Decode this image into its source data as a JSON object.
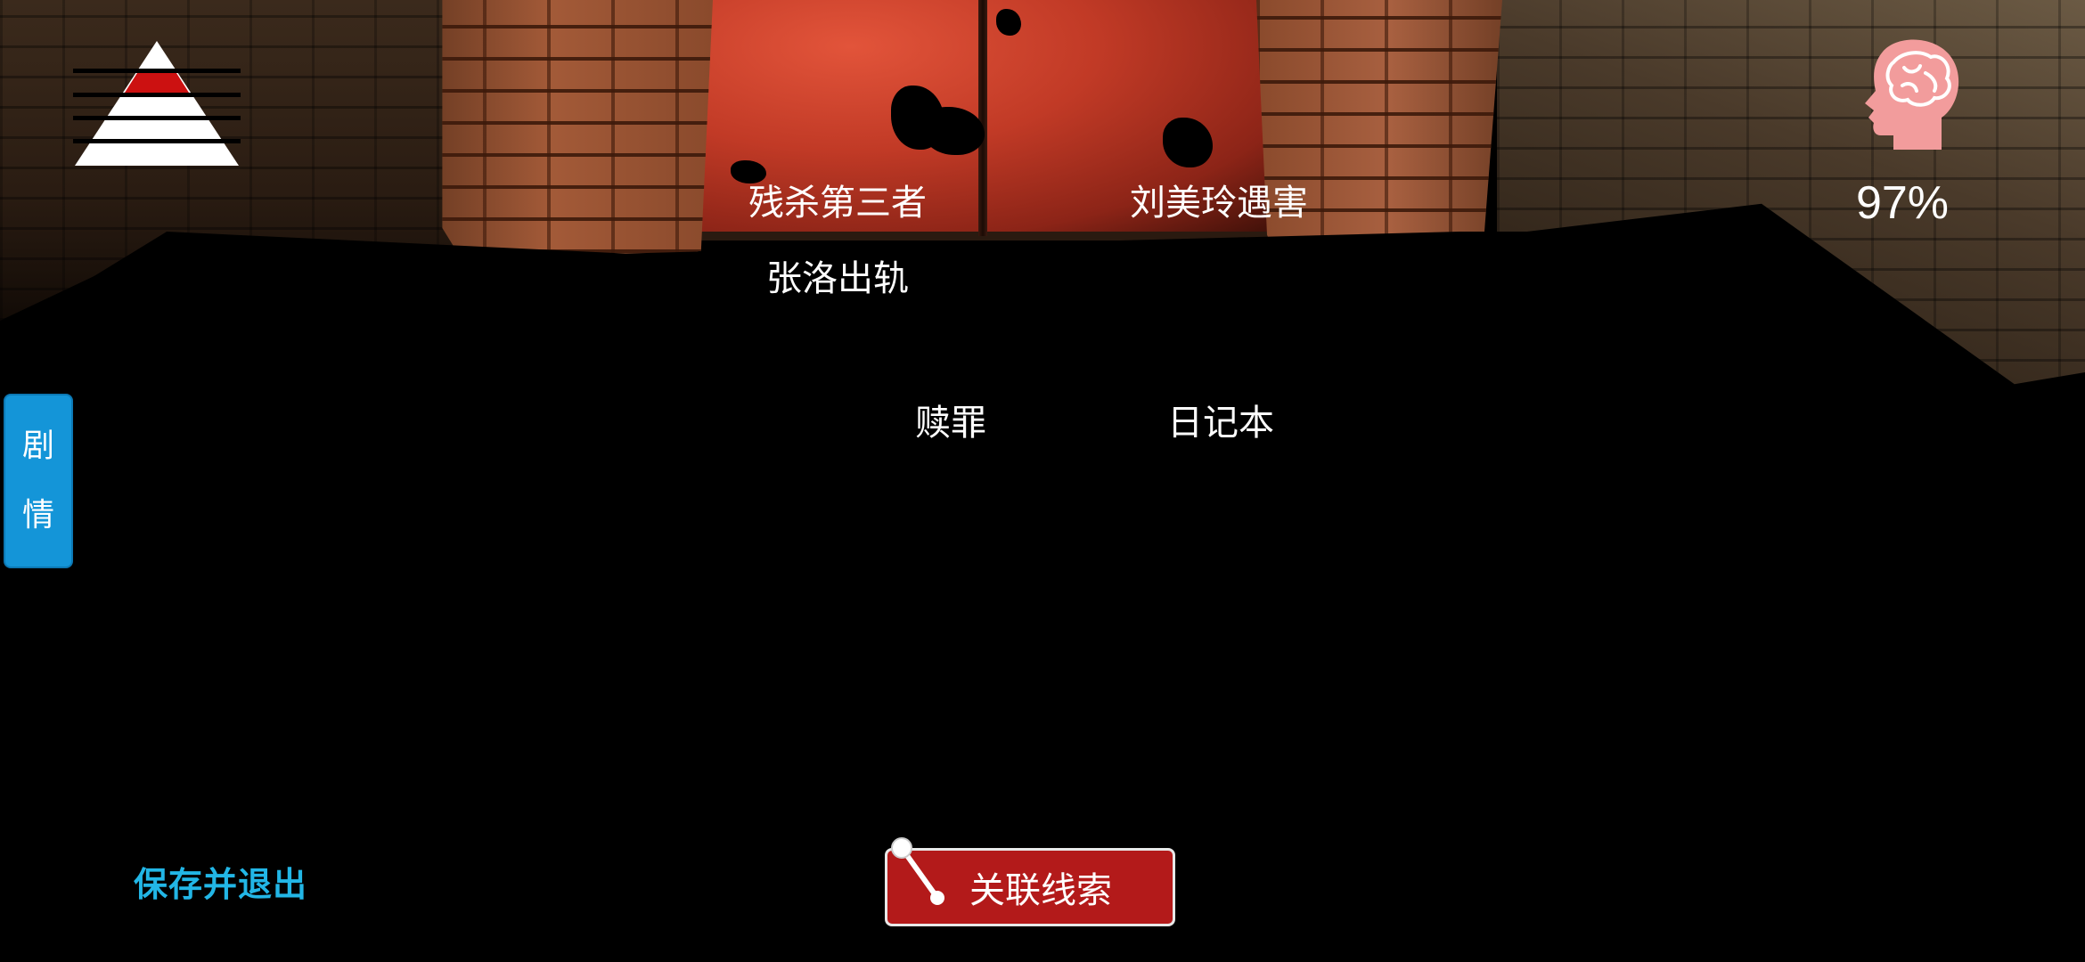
{
  "hud": {
    "sanity_percent": "97%",
    "pyramid_icon": "pyramid-level-icon",
    "brain_icon": "brain-head-icon",
    "brain_color": "#f29c9c",
    "pyramid_highlight": "#cc1111"
  },
  "sidebar": {
    "story_tab_chars": [
      "剧",
      "情"
    ],
    "tab_color": "#1495d8"
  },
  "clues": [
    "残杀第三者",
    "刘美玲遇害",
    "张洛出轨",
    "赎罪",
    "日记本"
  ],
  "footer": {
    "save_exit_label": "保存并退出",
    "link_clues_label": "关联线索",
    "link_button_color": "#b31a1a",
    "save_exit_color": "#22b6e6"
  }
}
